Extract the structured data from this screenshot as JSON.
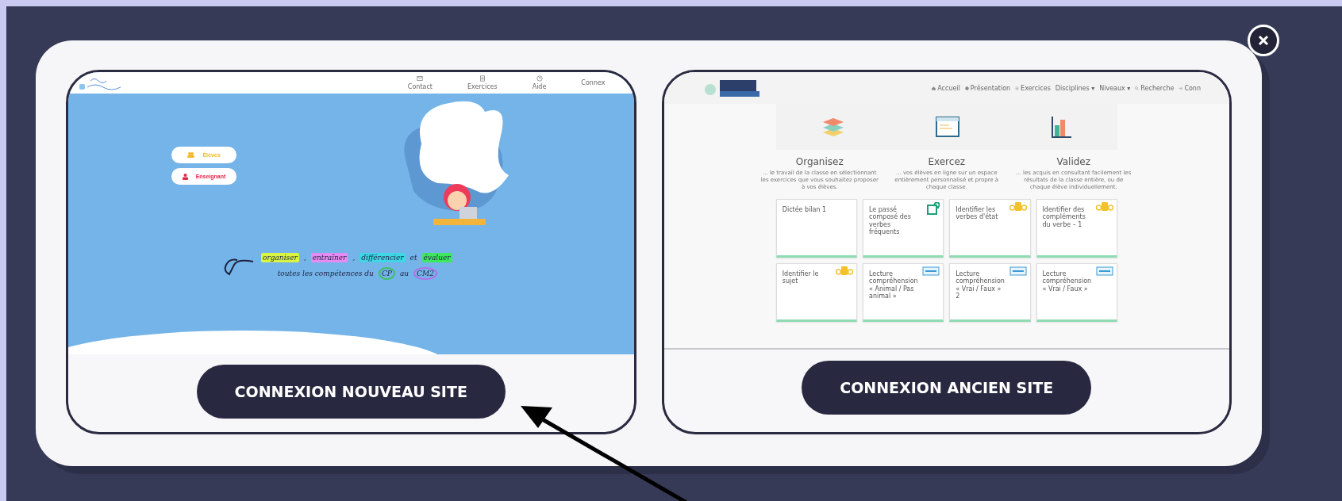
{
  "options": [
    {
      "kind": "new",
      "button": "CONNEXION NOUVEAU SITE",
      "nav": [
        {
          "label": "Contact",
          "kind": "mail"
        },
        {
          "label": "Exercices",
          "kind": "sheet"
        },
        {
          "label": "Aide",
          "kind": "help"
        },
        {
          "label": "Connex",
          "kind": "plain"
        }
      ],
      "roles": [
        {
          "label": "Élèves",
          "kind": "student"
        },
        {
          "label": "Enseignant",
          "kind": "teacher"
        }
      ],
      "tagline": [
        [
          {
            "text": "organiser",
            "kind": "highlight",
            "color": "#d9f542"
          },
          {
            "text": ",",
            "kind": "plain"
          },
          {
            "text": "entraîner",
            "kind": "highlight",
            "color": "#e58cf2"
          },
          {
            "text": ",",
            "kind": "plain"
          },
          {
            "text": "différencier",
            "kind": "highlight",
            "color": "#3fd6e6"
          },
          {
            "text": "et",
            "kind": "plain"
          },
          {
            "text": "évaluer",
            "kind": "highlight",
            "color": "#3ee85e"
          }
        ],
        [
          {
            "text": "toutes les compétences du",
            "kind": "plain"
          },
          {
            "text": "CP",
            "kind": "circle",
            "color": "#3fbf6a"
          },
          {
            "text": "au",
            "kind": "plain"
          },
          {
            "text": "CM2",
            "kind": "circle",
            "color": "#b070e8"
          }
        ]
      ]
    },
    {
      "kind": "old",
      "button": "CONNEXION ANCIEN SITE",
      "nav": [
        {
          "label": "Accueil",
          "kind": "home"
        },
        {
          "label": "Présentation",
          "kind": "info"
        },
        {
          "label": "Exercices",
          "kind": "list"
        },
        {
          "label": "Disciplines ▾",
          "kind": "plain"
        },
        {
          "label": "Niveaux ▾",
          "kind": "plain"
        },
        {
          "label": "Recherche",
          "kind": "search"
        },
        {
          "label": "Conn",
          "kind": "login"
        }
      ],
      "features": [
        {
          "kind": "layers",
          "title": "Organisez",
          "text": "... le travail de la classe en sélectionnant les exercices que vous souhaitez proposer à vos élèves."
        },
        {
          "kind": "window",
          "title": "Exercez",
          "text": "... vos élèves en ligne sur un espace entièrement personnalisé et propre à chaque classe."
        },
        {
          "kind": "chart",
          "title": "Validez",
          "text": "... les acquis en consultant facilement les résultats de la classe entière, ou de chaque élève individuellement."
        }
      ],
      "cards": [
        {
          "title": "Dictée bilan 1",
          "kind": "plain"
        },
        {
          "title": "Le passé composé des verbes fréquents",
          "kind": "edit"
        },
        {
          "title": "Identifier les verbes d'état",
          "kind": "letters"
        },
        {
          "title": "Identifier des compléments du verbe – 1",
          "kind": "letters"
        },
        {
          "title": "Identifier le sujet",
          "kind": "letters"
        },
        {
          "title": "Lecture compréhension « Animal / Pas animal »",
          "kind": "reading"
        },
        {
          "title": "Lecture compréhension « Vrai / Faux » 2",
          "kind": "reading"
        },
        {
          "title": "Lecture compréhension « Vrai / Faux »",
          "kind": "reading"
        }
      ]
    }
  ]
}
